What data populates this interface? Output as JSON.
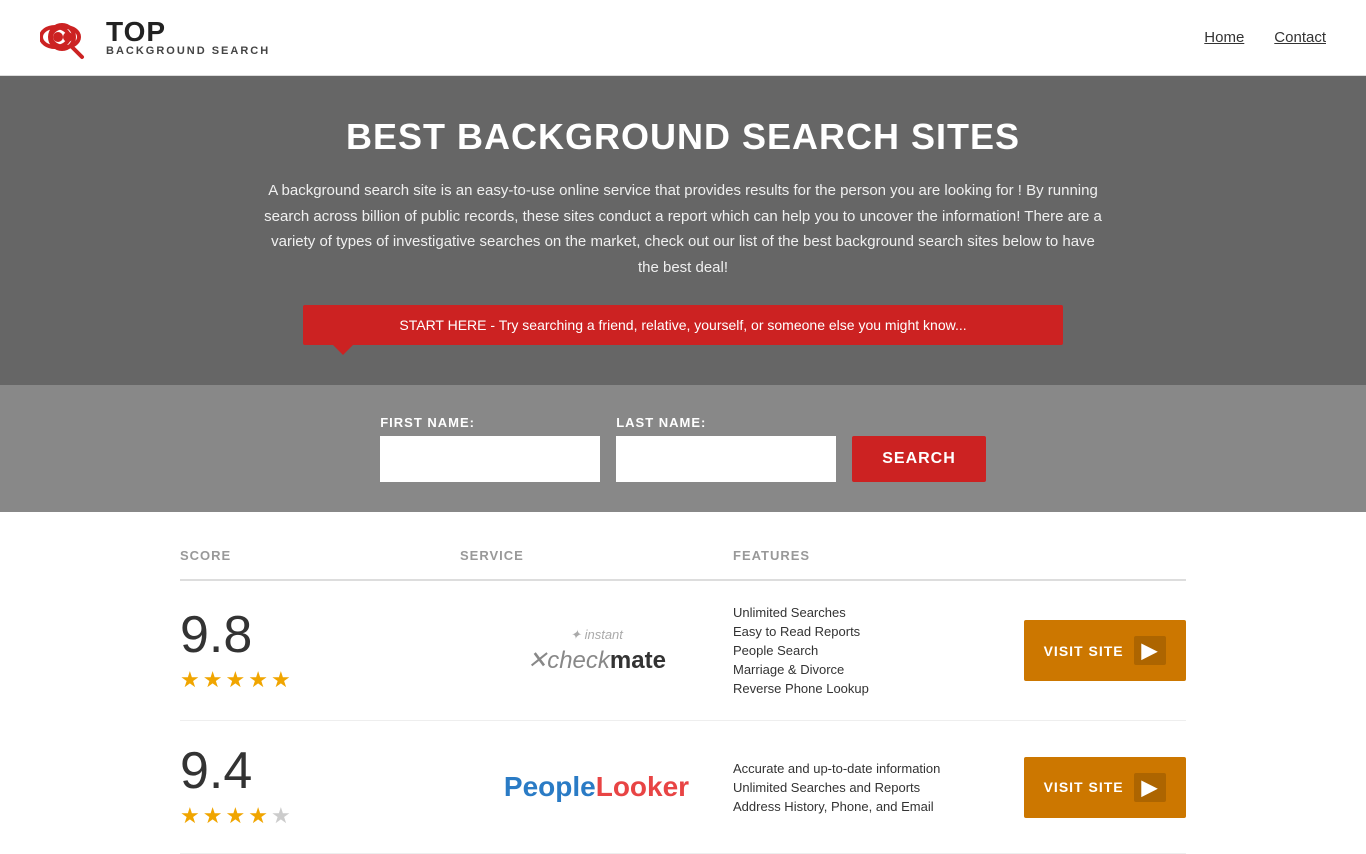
{
  "header": {
    "logo_top": "TOP",
    "logo_sub": "BACKGROUND SEARCH",
    "nav": [
      {
        "label": "Home",
        "href": "#"
      },
      {
        "label": "Contact",
        "href": "#"
      }
    ]
  },
  "hero": {
    "title": "BEST BACKGROUND SEARCH SITES",
    "description": "A background search site is an easy-to-use online service that provides results  for the person you are looking for ! By  running  search across billion of public records, these sites conduct  a report which can help you to uncover the information! There are a variety of types of investigative searches on the market, check out our  list of the best background search sites below to have the best deal!",
    "callout": "START HERE - Try searching a friend, relative, yourself, or someone else you might know..."
  },
  "search_form": {
    "first_name_label": "FIRST NAME:",
    "last_name_label": "LAST NAME:",
    "button_label": "SEARCH"
  },
  "table": {
    "headers": {
      "score": "SCORE",
      "service": "SERVICE",
      "features": "FEATURES"
    },
    "rows": [
      {
        "score": "9.8",
        "stars": 4.5,
        "service_name": "Instant Checkmate",
        "service_label": "instantcheckmate",
        "features": [
          "Unlimited Searches",
          "Easy to Read Reports",
          "People Search",
          "Marriage & Divorce",
          "Reverse Phone Lookup"
        ],
        "visit_label": "VISIT SITE"
      },
      {
        "score": "9.4",
        "stars": 4.5,
        "service_name": "PeopleLooker",
        "service_label": "peoplelooker",
        "features": [
          "Accurate and up-to-date information",
          "Unlimited Searches and Reports",
          "Address History, Phone, and Email"
        ],
        "visit_label": "VISIT SITE"
      }
    ]
  }
}
